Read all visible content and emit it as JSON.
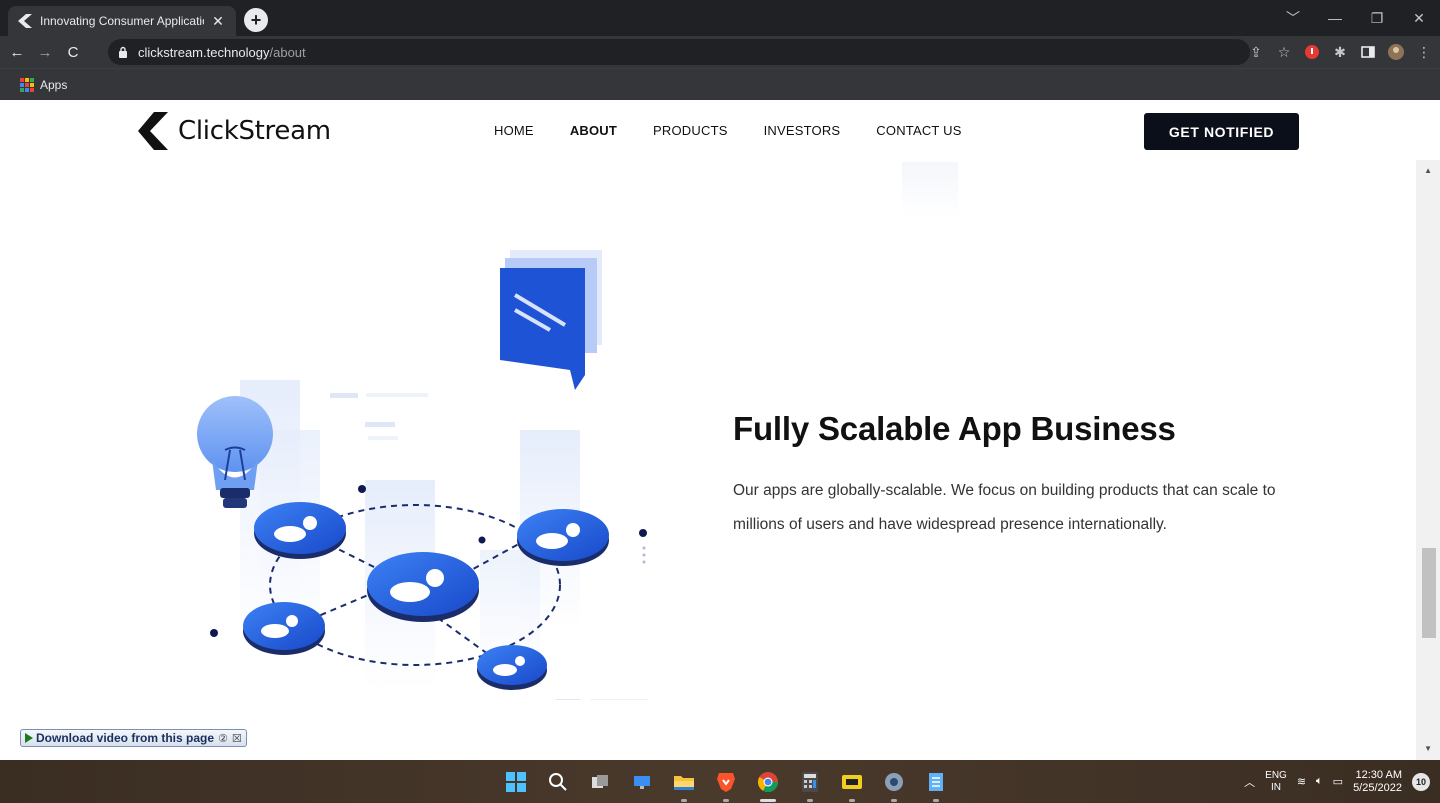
{
  "browser": {
    "tab_title": "Innovating Consumer Applicatio",
    "tab_close": "✕",
    "new_tab": "+",
    "url_host": "clickstream.technology",
    "url_path": "/about",
    "bookmark_apps": "Apps",
    "window_controls": [
      "﹀",
      "—",
      "❐",
      "✕"
    ],
    "accent": "#35363a"
  },
  "site": {
    "brand": "ClickStream",
    "nav": [
      "HOME",
      "ABOUT",
      "PRODUCTS",
      "INVESTORS",
      "CONTACT US"
    ],
    "active_nav": "ABOUT",
    "cta": "GET NOTIFIED"
  },
  "section": {
    "title": "Fully Scalable App Business",
    "body": "Our apps are globally-scalable. We focus on building products that can scale to millions of users and have widespread presence internationally.",
    "accent": "#1e5fe0"
  },
  "download_bar": {
    "label": "Download video from this page",
    "help": "②",
    "close": "☒"
  },
  "taskbar": {
    "lang_top": "ENG",
    "lang_bottom": "IN",
    "time": "12:30 AM",
    "date": "5/25/2022",
    "notifications": "10"
  }
}
